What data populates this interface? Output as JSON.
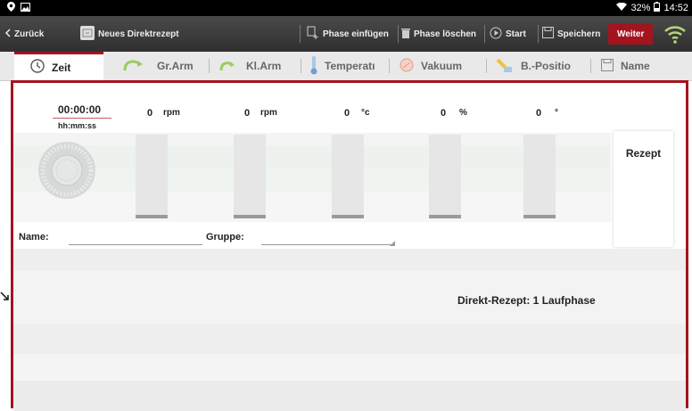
{
  "statusbar": {
    "battery": "32%",
    "time": "14:52",
    "left_icons": [
      "location-icon",
      "image-icon"
    ]
  },
  "actionbar": {
    "back_label": "Zurück",
    "title": "Neues Direktrezept",
    "insert_phase": "Phase einfügen",
    "delete_phase": "Phase löschen",
    "start": "Start",
    "save": "Speichern",
    "next": "Weiter",
    "accent": "#a3141f"
  },
  "tabs": [
    {
      "label": "Zeit",
      "icon": "clock-icon",
      "active": true
    },
    {
      "label": "Gr.Arm",
      "icon": "large-arm-icon",
      "active": false
    },
    {
      "label": "Kl.Arm",
      "icon": "small-arm-icon",
      "active": false
    },
    {
      "label": "Temperatı",
      "icon": "thermometer-icon",
      "active": false
    },
    {
      "label": "Vakuum",
      "icon": "vacuum-icon",
      "active": false
    },
    {
      "label": "B.-Positio",
      "icon": "bowl-position-icon",
      "active": false
    },
    {
      "label": "Name",
      "icon": "save-name-icon",
      "active": false
    }
  ],
  "values": {
    "time": "00:00:00",
    "time_format": "hh:mm:ss",
    "gr_arm": {
      "value": "0",
      "unit": "rpm"
    },
    "kl_arm": {
      "value": "0",
      "unit": "rpm"
    },
    "temperature": {
      "value": "0",
      "unit": "°c"
    },
    "vacuum": {
      "value": "0",
      "unit": "%"
    },
    "position": {
      "value": "0",
      "unit": "°"
    }
  },
  "rezept_label": "Rezept",
  "form": {
    "name_label": "Name:",
    "name_value": "",
    "group_label": "Gruppe:",
    "group_value": ""
  },
  "info_text": "Direkt-Rezept: 1 Laufphase"
}
